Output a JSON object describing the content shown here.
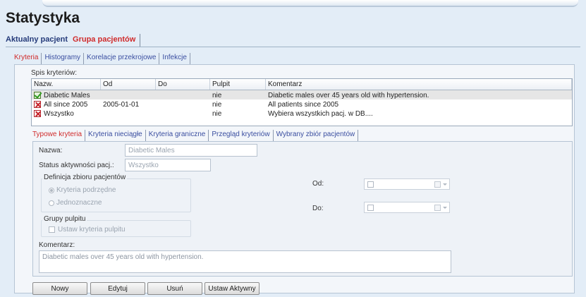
{
  "page": {
    "title": "Statystyka"
  },
  "top_tabs": [
    "Aktualny pacjent",
    "Grupa pacjentów"
  ],
  "sub_tabs": [
    "Kryteria",
    "Histogramy",
    "Korelacje przekrojowe",
    "Infekcje"
  ],
  "criteria_list": {
    "label": "Spis kryteriów:",
    "columns": [
      "Nazw.",
      "Od",
      "Do",
      "Pulpit",
      "Komentarz"
    ],
    "rows": [
      {
        "icon": "check-icon",
        "name": "Diabetic Males",
        "od": "",
        "do": "",
        "pulpit": "nie",
        "comment": "Diabetic males over 45 years old with hypertension."
      },
      {
        "icon": "cross-icon",
        "name": "All since 2005",
        "od": "2005-01-01",
        "do": "",
        "pulpit": "nie",
        "comment": "All patients since 2005"
      },
      {
        "icon": "cross-icon",
        "name": "Wszystko",
        "od": "",
        "do": "",
        "pulpit": "nie",
        "comment": "Wybiera wszystkich pacj. w DB...."
      }
    ]
  },
  "detail_tabs": [
    "Typowe kryteria",
    "Kryteria nieciągłe",
    "Kryteria graniczne",
    "Przegląd kryteriów",
    "Wybrany zbiór pacjentów"
  ],
  "form": {
    "name_label": "Nazwa:",
    "name_value": "Diabetic Males",
    "status_label": "Status aktywności pacj.:",
    "status_value": "Wszystko",
    "group_def_title": "Definicja zbioru pacjentów",
    "radio_sub": "Kryteria podrzędne",
    "radio_unique": "Jednoznaczne",
    "dashboard_group_title": "Grupy pulpitu",
    "dashboard_checkbox": "Ustaw kryteria pulpitu",
    "od_label": "Od:",
    "do_label": "Do:",
    "comment_label": "Komentarz:",
    "comment_value": "Diabetic males over 45 years old with hypertension."
  },
  "buttons": [
    "Nowy",
    "Edytuj",
    "Usuń",
    "Ustaw Aktywny"
  ]
}
